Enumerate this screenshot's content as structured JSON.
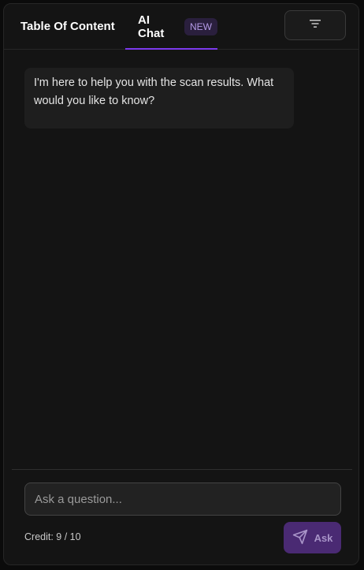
{
  "tabs": {
    "toc_label": "Table Of Content",
    "chat_label": "AI Chat",
    "chat_badge": "NEW"
  },
  "toolbar": {
    "filter_icon": "filter-icon"
  },
  "chat": {
    "messages": [
      {
        "role": "assistant",
        "text": "I'm here to help you with the scan results. What would you like to know?"
      }
    ]
  },
  "composer": {
    "placeholder": "Ask a question...",
    "value": "",
    "credit": "Credit: 9 / 10",
    "ask_label": "Ask",
    "send_icon": "send-icon"
  },
  "colors": {
    "accent": "#7c3aed",
    "badge_bg": "#2a1f3d",
    "badge_text": "#b49ae6",
    "ask_bg": "#4a2a73",
    "panel_bg": "#141414"
  }
}
